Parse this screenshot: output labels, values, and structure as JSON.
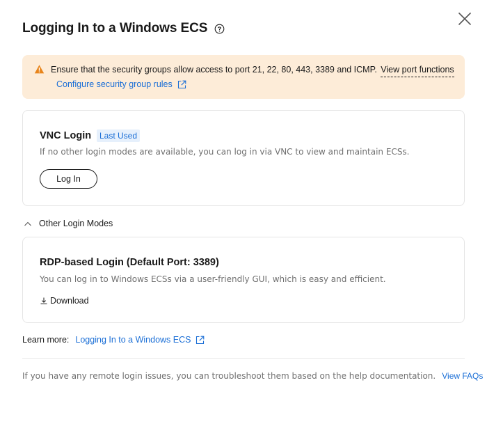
{
  "dialog": {
    "title": "Logging In to a Windows ECS",
    "help_icon": "question-circle-icon",
    "close_icon": "close-icon"
  },
  "alert": {
    "icon": "warning-triangle-icon",
    "color": "#fdecd8",
    "text": "Ensure that the security groups allow access to port 21, 22, 80, 443, 3389 and ICMP.",
    "port_link": "View port functions",
    "config_link": "Configure security group rules"
  },
  "vnc": {
    "title": "VNC Login",
    "badge": "Last Used",
    "description": "If no other login modes are available, you can log in via VNC to view and maintain ECSs.",
    "button": "Log In"
  },
  "other_modes": {
    "label": "Other Login Modes",
    "expanded": true
  },
  "rdp": {
    "title": "RDP-based Login (Default Port: 3389)",
    "description": "You can log in to Windows ECSs via a user-friendly GUI, which is easy and efficient.",
    "download": "Download"
  },
  "learn_more": {
    "label": "Learn more:",
    "link": "Logging In to a Windows ECS"
  },
  "footer": {
    "text": "If you have any remote login issues, you can troubleshoot them based on the help documentation.",
    "link": "View FAQs"
  },
  "colors": {
    "accent": "#1a6ed6",
    "warning": "#e8841a"
  }
}
